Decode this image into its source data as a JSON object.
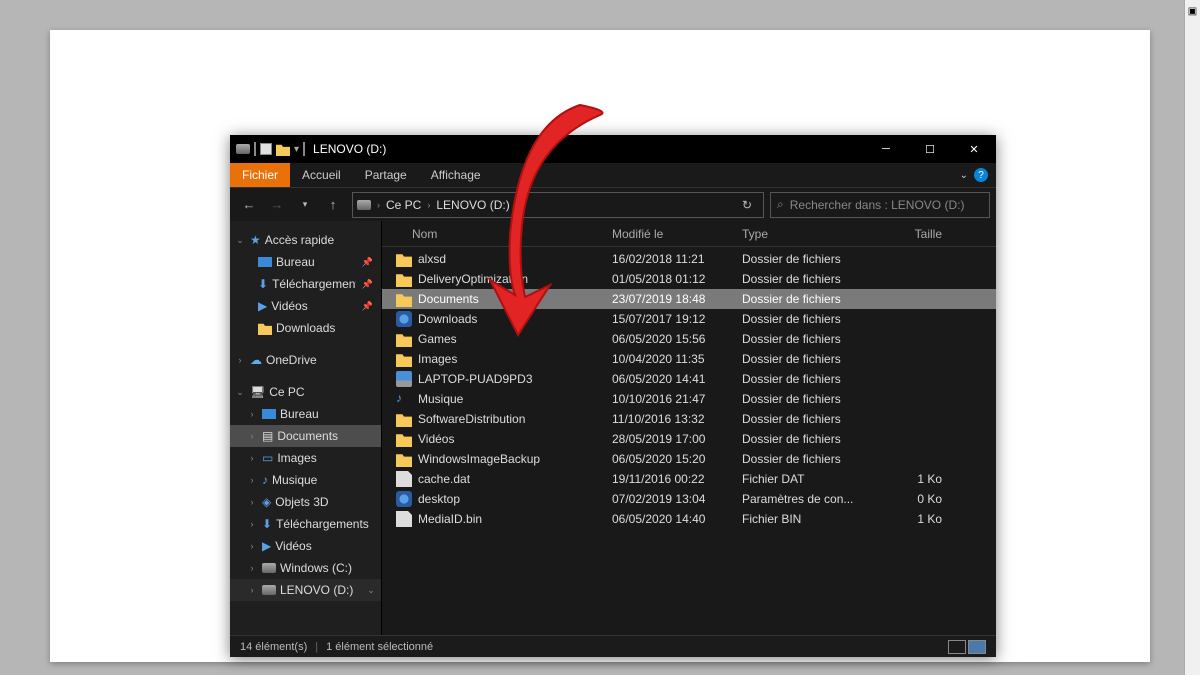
{
  "window": {
    "title": "LENOVO (D:)",
    "ribbon": {
      "file": "Fichier",
      "home": "Accueil",
      "share": "Partage",
      "view": "Affichage"
    }
  },
  "address": {
    "crumbs": [
      "Ce PC",
      "LENOVO (D:)"
    ]
  },
  "search": {
    "placeholder": "Rechercher dans : LENOVO (D:)"
  },
  "columns": {
    "name": "Nom",
    "modified": "Modifié le",
    "type": "Type",
    "size": "Taille"
  },
  "sidebar": {
    "quick": "Accès rapide",
    "quick_items": [
      {
        "label": "Bureau",
        "pin": true
      },
      {
        "label": "Téléchargements",
        "pin": true
      },
      {
        "label": "Vidéos",
        "pin": true
      },
      {
        "label": "Downloads",
        "pin": false
      }
    ],
    "onedrive": "OneDrive",
    "thispc": "Ce PC",
    "pc_items": [
      {
        "label": "Bureau"
      },
      {
        "label": "Documents",
        "sel": true
      },
      {
        "label": "Images"
      },
      {
        "label": "Musique"
      },
      {
        "label": "Objets 3D"
      },
      {
        "label": "Téléchargements"
      },
      {
        "label": "Vidéos"
      },
      {
        "label": "Windows (C:)"
      },
      {
        "label": "LENOVO (D:)"
      }
    ]
  },
  "files": [
    {
      "name": "alxsd",
      "mod": "16/02/2018 11:21",
      "type": "Dossier de fichiers",
      "size": "",
      "icon": "folder"
    },
    {
      "name": "DeliveryOptimization",
      "mod": "01/05/2018 01:12",
      "type": "Dossier de fichiers",
      "size": "",
      "icon": "folder"
    },
    {
      "name": "Documents",
      "mod": "23/07/2019 18:48",
      "type": "Dossier de fichiers",
      "size": "",
      "icon": "folder",
      "sel": true
    },
    {
      "name": "Downloads",
      "mod": "15/07/2017 19:12",
      "type": "Dossier de fichiers",
      "size": "",
      "icon": "gear"
    },
    {
      "name": "Games",
      "mod": "06/05/2020 15:56",
      "type": "Dossier de fichiers",
      "size": "",
      "icon": "folder"
    },
    {
      "name": "Images",
      "mod": "10/04/2020 11:35",
      "type": "Dossier de fichiers",
      "size": "",
      "icon": "folder"
    },
    {
      "name": "LAPTOP-PUAD9PD3",
      "mod": "06/05/2020 14:41",
      "type": "Dossier de fichiers",
      "size": "",
      "icon": "pc"
    },
    {
      "name": "Musique",
      "mod": "10/10/2016 21:47",
      "type": "Dossier de fichiers",
      "size": "",
      "icon": "music"
    },
    {
      "name": "SoftwareDistribution",
      "mod": "11/10/2016 13:32",
      "type": "Dossier de fichiers",
      "size": "",
      "icon": "folder"
    },
    {
      "name": "Vidéos",
      "mod": "28/05/2019 17:00",
      "type": "Dossier de fichiers",
      "size": "",
      "icon": "folder"
    },
    {
      "name": "WindowsImageBackup",
      "mod": "06/05/2020 15:20",
      "type": "Dossier de fichiers",
      "size": "",
      "icon": "folder"
    },
    {
      "name": "cache.dat",
      "mod": "19/11/2016 00:22",
      "type": "Fichier DAT",
      "size": "1 Ko",
      "icon": "file"
    },
    {
      "name": "desktop",
      "mod": "07/02/2019 13:04",
      "type": "Paramètres de con...",
      "size": "0 Ko",
      "icon": "gear"
    },
    {
      "name": "MediaID.bin",
      "mod": "06/05/2020 14:40",
      "type": "Fichier BIN",
      "size": "1 Ko",
      "icon": "file"
    }
  ],
  "status": {
    "count": "14 élément(s)",
    "sel": "1 élément sélectionné"
  }
}
